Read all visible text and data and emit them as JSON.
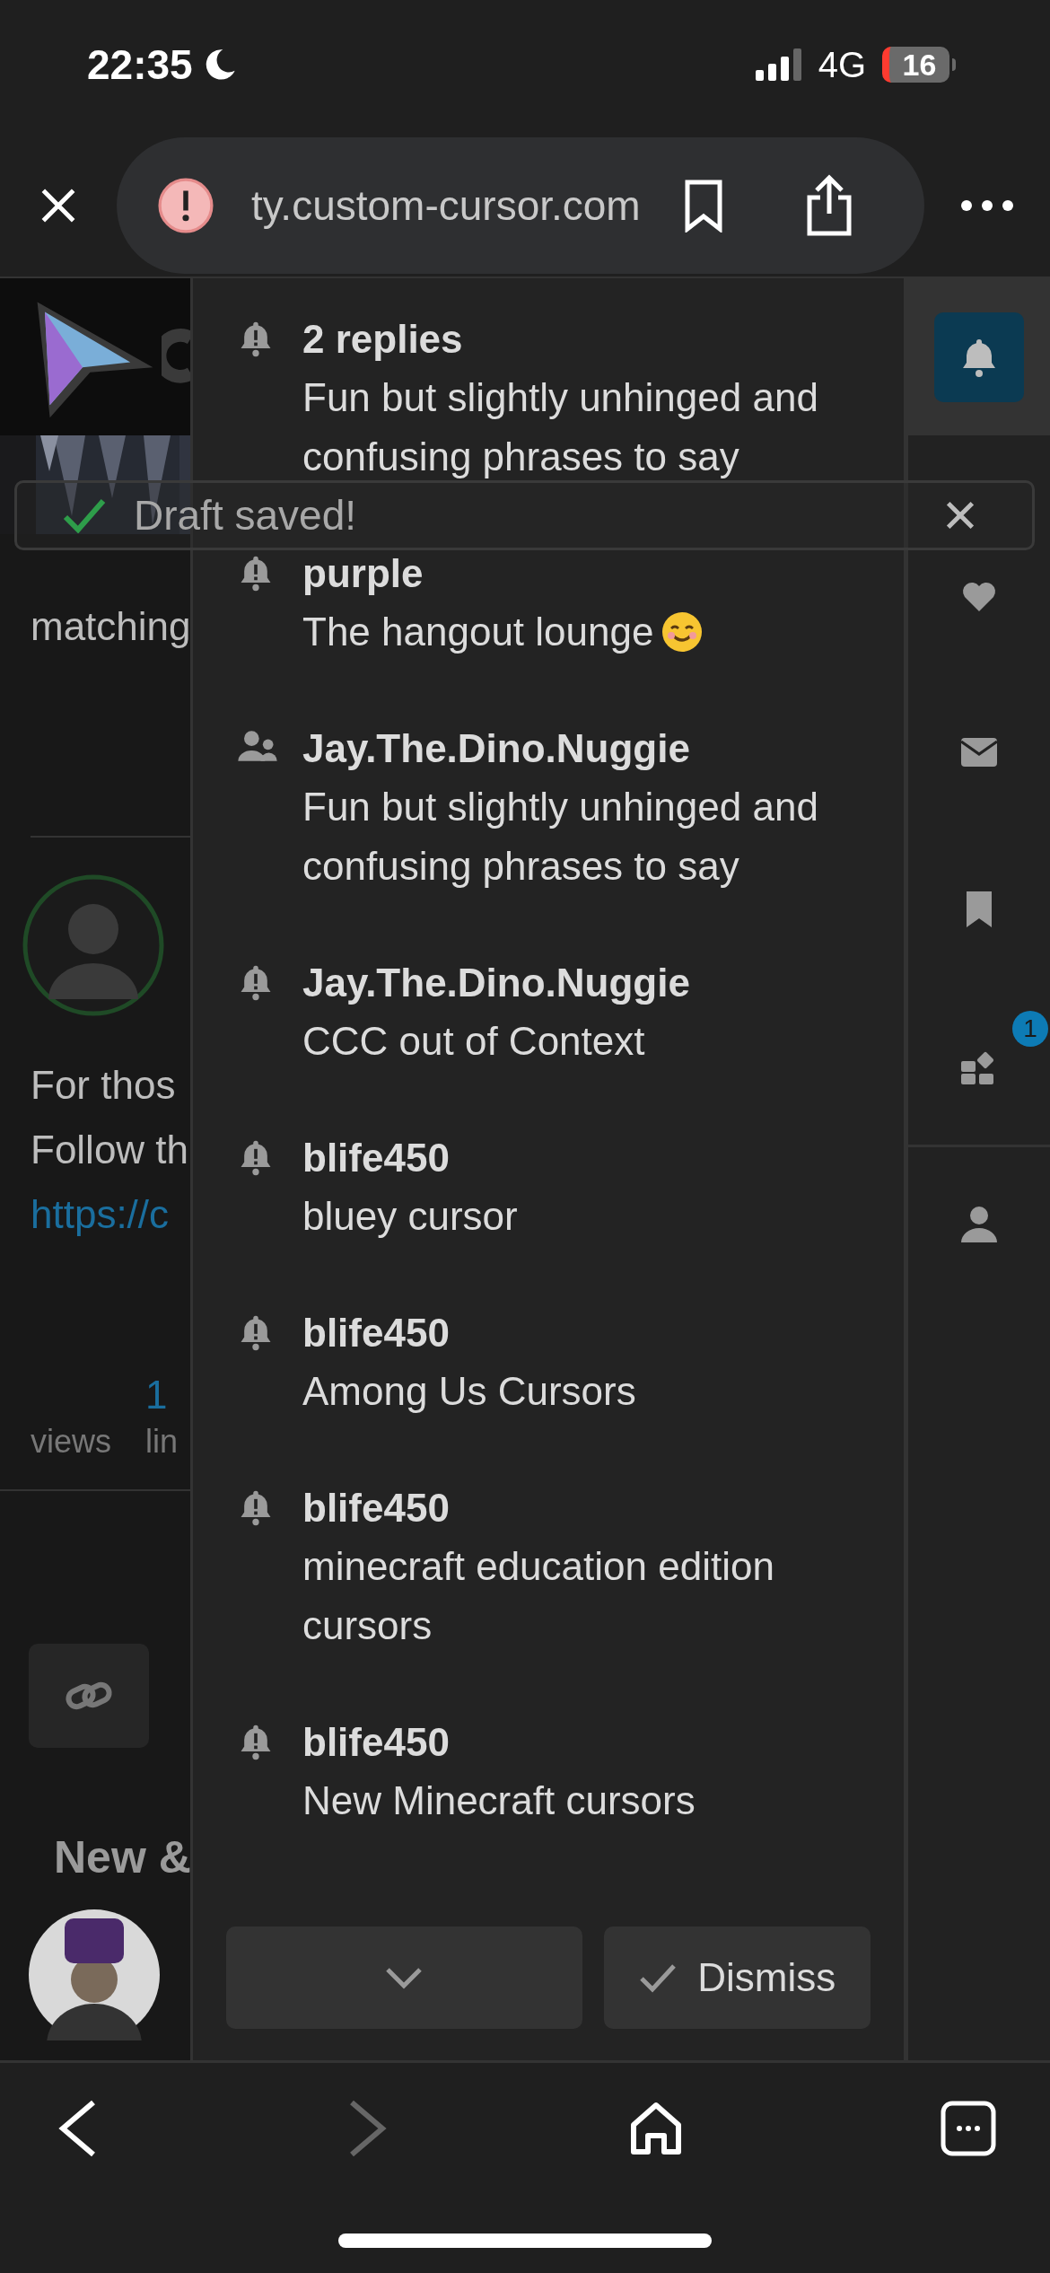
{
  "status_bar": {
    "time": "22:35",
    "network": "4G",
    "battery": "16"
  },
  "browser": {
    "url": "ty.custom-cursor.com"
  },
  "background": {
    "snippet": "matching",
    "post_lines": [
      "For thos",
      "Follow th"
    ],
    "link": "https://c",
    "stats": [
      {
        "label": "views"
      },
      {
        "value": "1",
        "label": "lin"
      }
    ],
    "heading": "New &"
  },
  "toast": {
    "text": "Draft saved!"
  },
  "notifications": [
    {
      "kind": "bell",
      "title": "2 replies",
      "text": "Fun but slightly unhinged and confusing phrases to say"
    },
    {
      "kind": "bell",
      "title": "purple",
      "text": "The hangout lounge",
      "emoji": true
    },
    {
      "kind": "group",
      "title": "Jay.The.Dino.Nuggie",
      "text": "Fun but slightly unhinged and confusing phrases to say"
    },
    {
      "kind": "bell",
      "title": "Jay.The.Dino.Nuggie",
      "text": "CCC out of Context"
    },
    {
      "kind": "bell",
      "title": "blife450",
      "text": "bluey cursor"
    },
    {
      "kind": "bell",
      "title": "blife450",
      "text": "Among Us Cursors"
    },
    {
      "kind": "bell",
      "title": "blife450",
      "text": "minecraft education edition cursors"
    },
    {
      "kind": "bell",
      "title": "blife450",
      "text": "New Minecraft cursors"
    }
  ],
  "actions": {
    "dismiss": "Dismiss"
  },
  "rail": [
    {
      "kind": "bell",
      "selected": true
    },
    {
      "kind": "heart",
      "selected": false
    },
    {
      "kind": "mail",
      "selected": false
    },
    {
      "kind": "bookmark",
      "selected": false
    },
    {
      "kind": "grid",
      "selected": false,
      "badge": "1"
    },
    {
      "kind": "person",
      "selected": false
    }
  ]
}
